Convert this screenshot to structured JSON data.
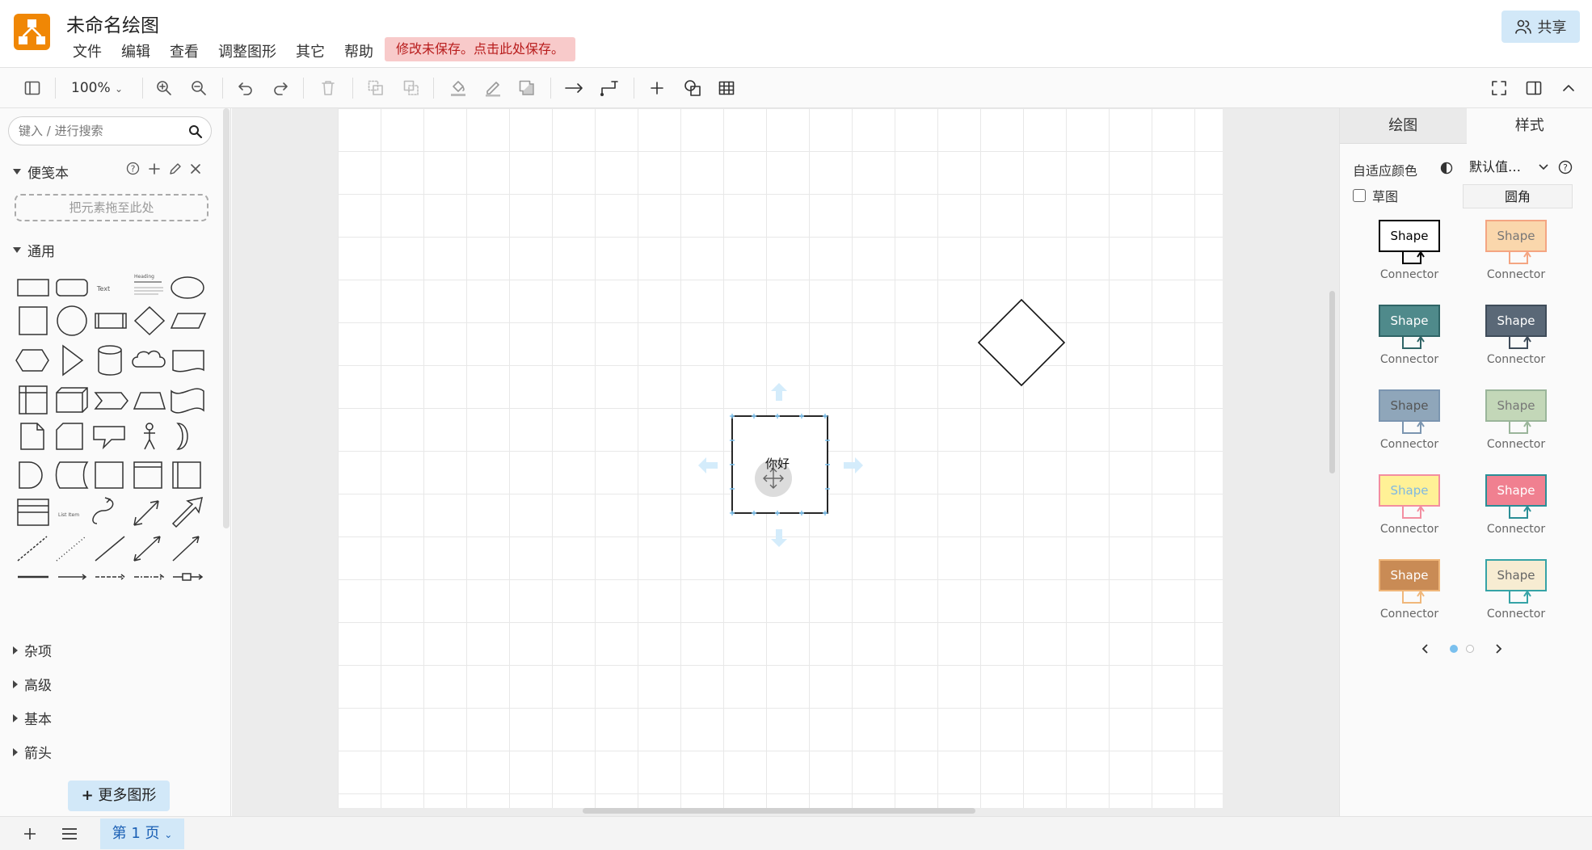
{
  "app": {
    "title": "未命名绘图",
    "menu": [
      "文件",
      "编辑",
      "查看",
      "调整图形",
      "其它",
      "帮助"
    ],
    "unsaved_notice": "修改未保存。点击此处保存。",
    "share_label": "共享",
    "accent": "#f08705"
  },
  "toolbar": {
    "zoom": "100%"
  },
  "left": {
    "search_placeholder": "键入 / 进行搜索",
    "scratchpad_title": "便笺本",
    "drop_hint": "把元素拖至此处",
    "general_title": "通用",
    "shape_text_label": "Text",
    "shape_heading_label": "Heading",
    "shape_list_label": "List Item",
    "sections": [
      "杂项",
      "高级",
      "基本",
      "箭头"
    ],
    "more_shapes": "更多图形"
  },
  "canvas": {
    "shape_text": "你好"
  },
  "right": {
    "tabs": [
      "绘图",
      "样式"
    ],
    "adaptive_color": "自适应颜色",
    "default_value": "默认值…",
    "sketch": "草图",
    "rounded": "圆角",
    "styles": [
      {
        "shape": "Shape",
        "connector": "Connector",
        "fill": "#ffffff",
        "stroke": "#000000",
        "text": "#000000"
      },
      {
        "shape": "Shape",
        "connector": "Connector",
        "fill": "#fad7ac",
        "stroke": "#f4a582",
        "text": "#777777"
      },
      {
        "shape": "Shape",
        "connector": "Connector",
        "fill": "#4f8a8b",
        "stroke": "#2f6466",
        "text": "#ffffff"
      },
      {
        "shape": "Shape",
        "connector": "Connector",
        "fill": "#5a6877",
        "stroke": "#3f4c5a",
        "text": "#ffffff"
      },
      {
        "shape": "Shape",
        "connector": "Connector",
        "fill": "#8fa6ba",
        "stroke": "#7b95b0",
        "text": "#555555"
      },
      {
        "shape": "Shape",
        "connector": "Connector",
        "fill": "#c3d7b8",
        "stroke": "#9ab59a",
        "text": "#777777"
      },
      {
        "shape": "Shape",
        "connector": "Connector",
        "fill": "#fff196",
        "stroke": "#f38ea0",
        "text": "#7fb8e2"
      },
      {
        "shape": "Shape",
        "connector": "Connector",
        "fill": "#f08090",
        "stroke": "#2a8e96",
        "text": "#ffffff"
      },
      {
        "shape": "Shape",
        "connector": "Connector",
        "fill": "#c98b55",
        "stroke": "#f0b77a",
        "text": "#ffffff"
      },
      {
        "shape": "Shape",
        "connector": "Connector",
        "fill": "#f7ecd2",
        "stroke": "#36a3a6",
        "text": "#666666"
      }
    ]
  },
  "bottom": {
    "page_tab": "第 1 页"
  }
}
